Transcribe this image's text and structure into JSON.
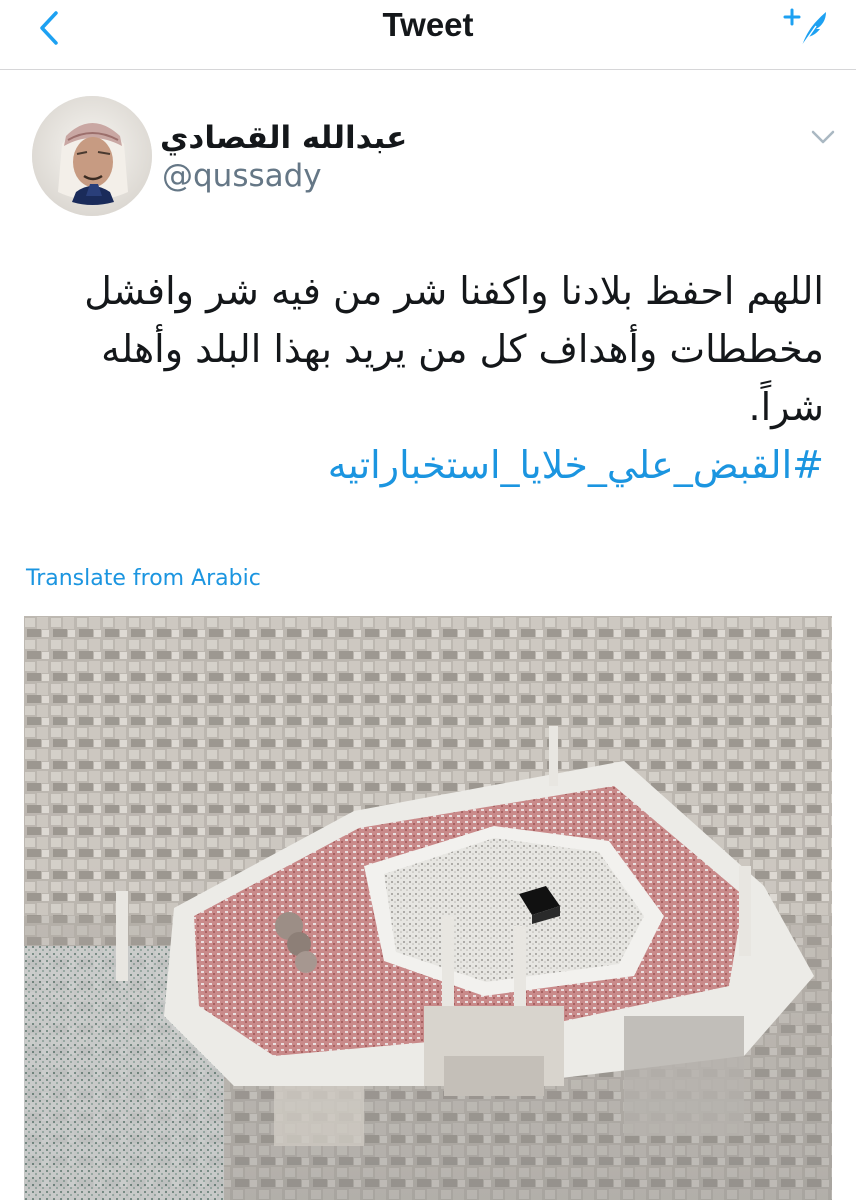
{
  "nav": {
    "title": "Tweet",
    "back_icon": "chevron-left-icon",
    "compose_icon": "compose-tweet-icon",
    "accent": "#1da1f2"
  },
  "tweet": {
    "author": {
      "display_name": "عبدالله القصادي",
      "handle": "@qussady",
      "avatar_icon": "avatar"
    },
    "body": "اللهم احفظ بلادنا واكفنا شر من فيه شر وافشل مخططات وأهداف كل من يريد بهذا البلد وأهله شراً.",
    "hashtag": "#القبض_علي_خلايا_استخباراتيه",
    "translate_label": "Translate from Arabic",
    "link_color": "#1b95e0",
    "media": {
      "type": "photo",
      "description_icon": "photo-mecca-grand-mosque"
    }
  }
}
